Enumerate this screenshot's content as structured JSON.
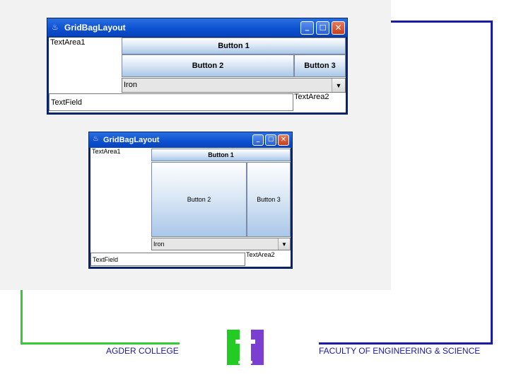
{
  "window_large": {
    "title": "GridBagLayout",
    "textarea1": "TextArea1",
    "button1": "Button 1",
    "button2": "Button 2",
    "button3": "Button 3",
    "combo_value": "Iron",
    "textfield": "TextField",
    "textarea2": "TextArea2"
  },
  "window_small": {
    "title": "GridBagLayout",
    "textarea1": "TextArea1",
    "button1": "Button 1",
    "button2": "Button 2",
    "button3": "Button 3",
    "combo_value": "Iron",
    "textfield": "TextField",
    "textarea2": "TextArea2"
  },
  "footer": {
    "left": "AGDER COLLEGE",
    "right": "FACULTY OF ENGINEERING & SCIENCE"
  },
  "colors": {
    "frame_blue": "#1a1aa8",
    "frame_green": "#33cc33",
    "logo_green": "#22cc22",
    "logo_purple": "#7a3fd0"
  }
}
